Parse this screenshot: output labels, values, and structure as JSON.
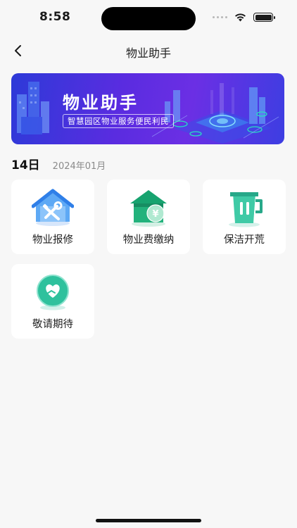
{
  "status_bar": {
    "time": "8:58"
  },
  "nav": {
    "title": "物业助手"
  },
  "banner": {
    "title": "物业助手",
    "subtitle": "智慧园区物业服务便民利民"
  },
  "date": {
    "day": "14日",
    "month": "2024年01月"
  },
  "services": [
    {
      "label": "物业报修",
      "icon": "repair-house-icon"
    },
    {
      "label": "物业费缴纳",
      "icon": "fee-payment-house-icon"
    },
    {
      "label": "保洁开荒",
      "icon": "cleaning-bucket-icon"
    },
    {
      "label": "敬请期待",
      "icon": "heart-hand-icon"
    }
  ],
  "colors": {
    "background": "#f7f7f7",
    "banner_start": "#2d3ad8",
    "banner_end": "#6b2fe4",
    "repair_blue": "#2f8ef0",
    "fee_green": "#21b07a",
    "clean_teal": "#35c7a3"
  }
}
